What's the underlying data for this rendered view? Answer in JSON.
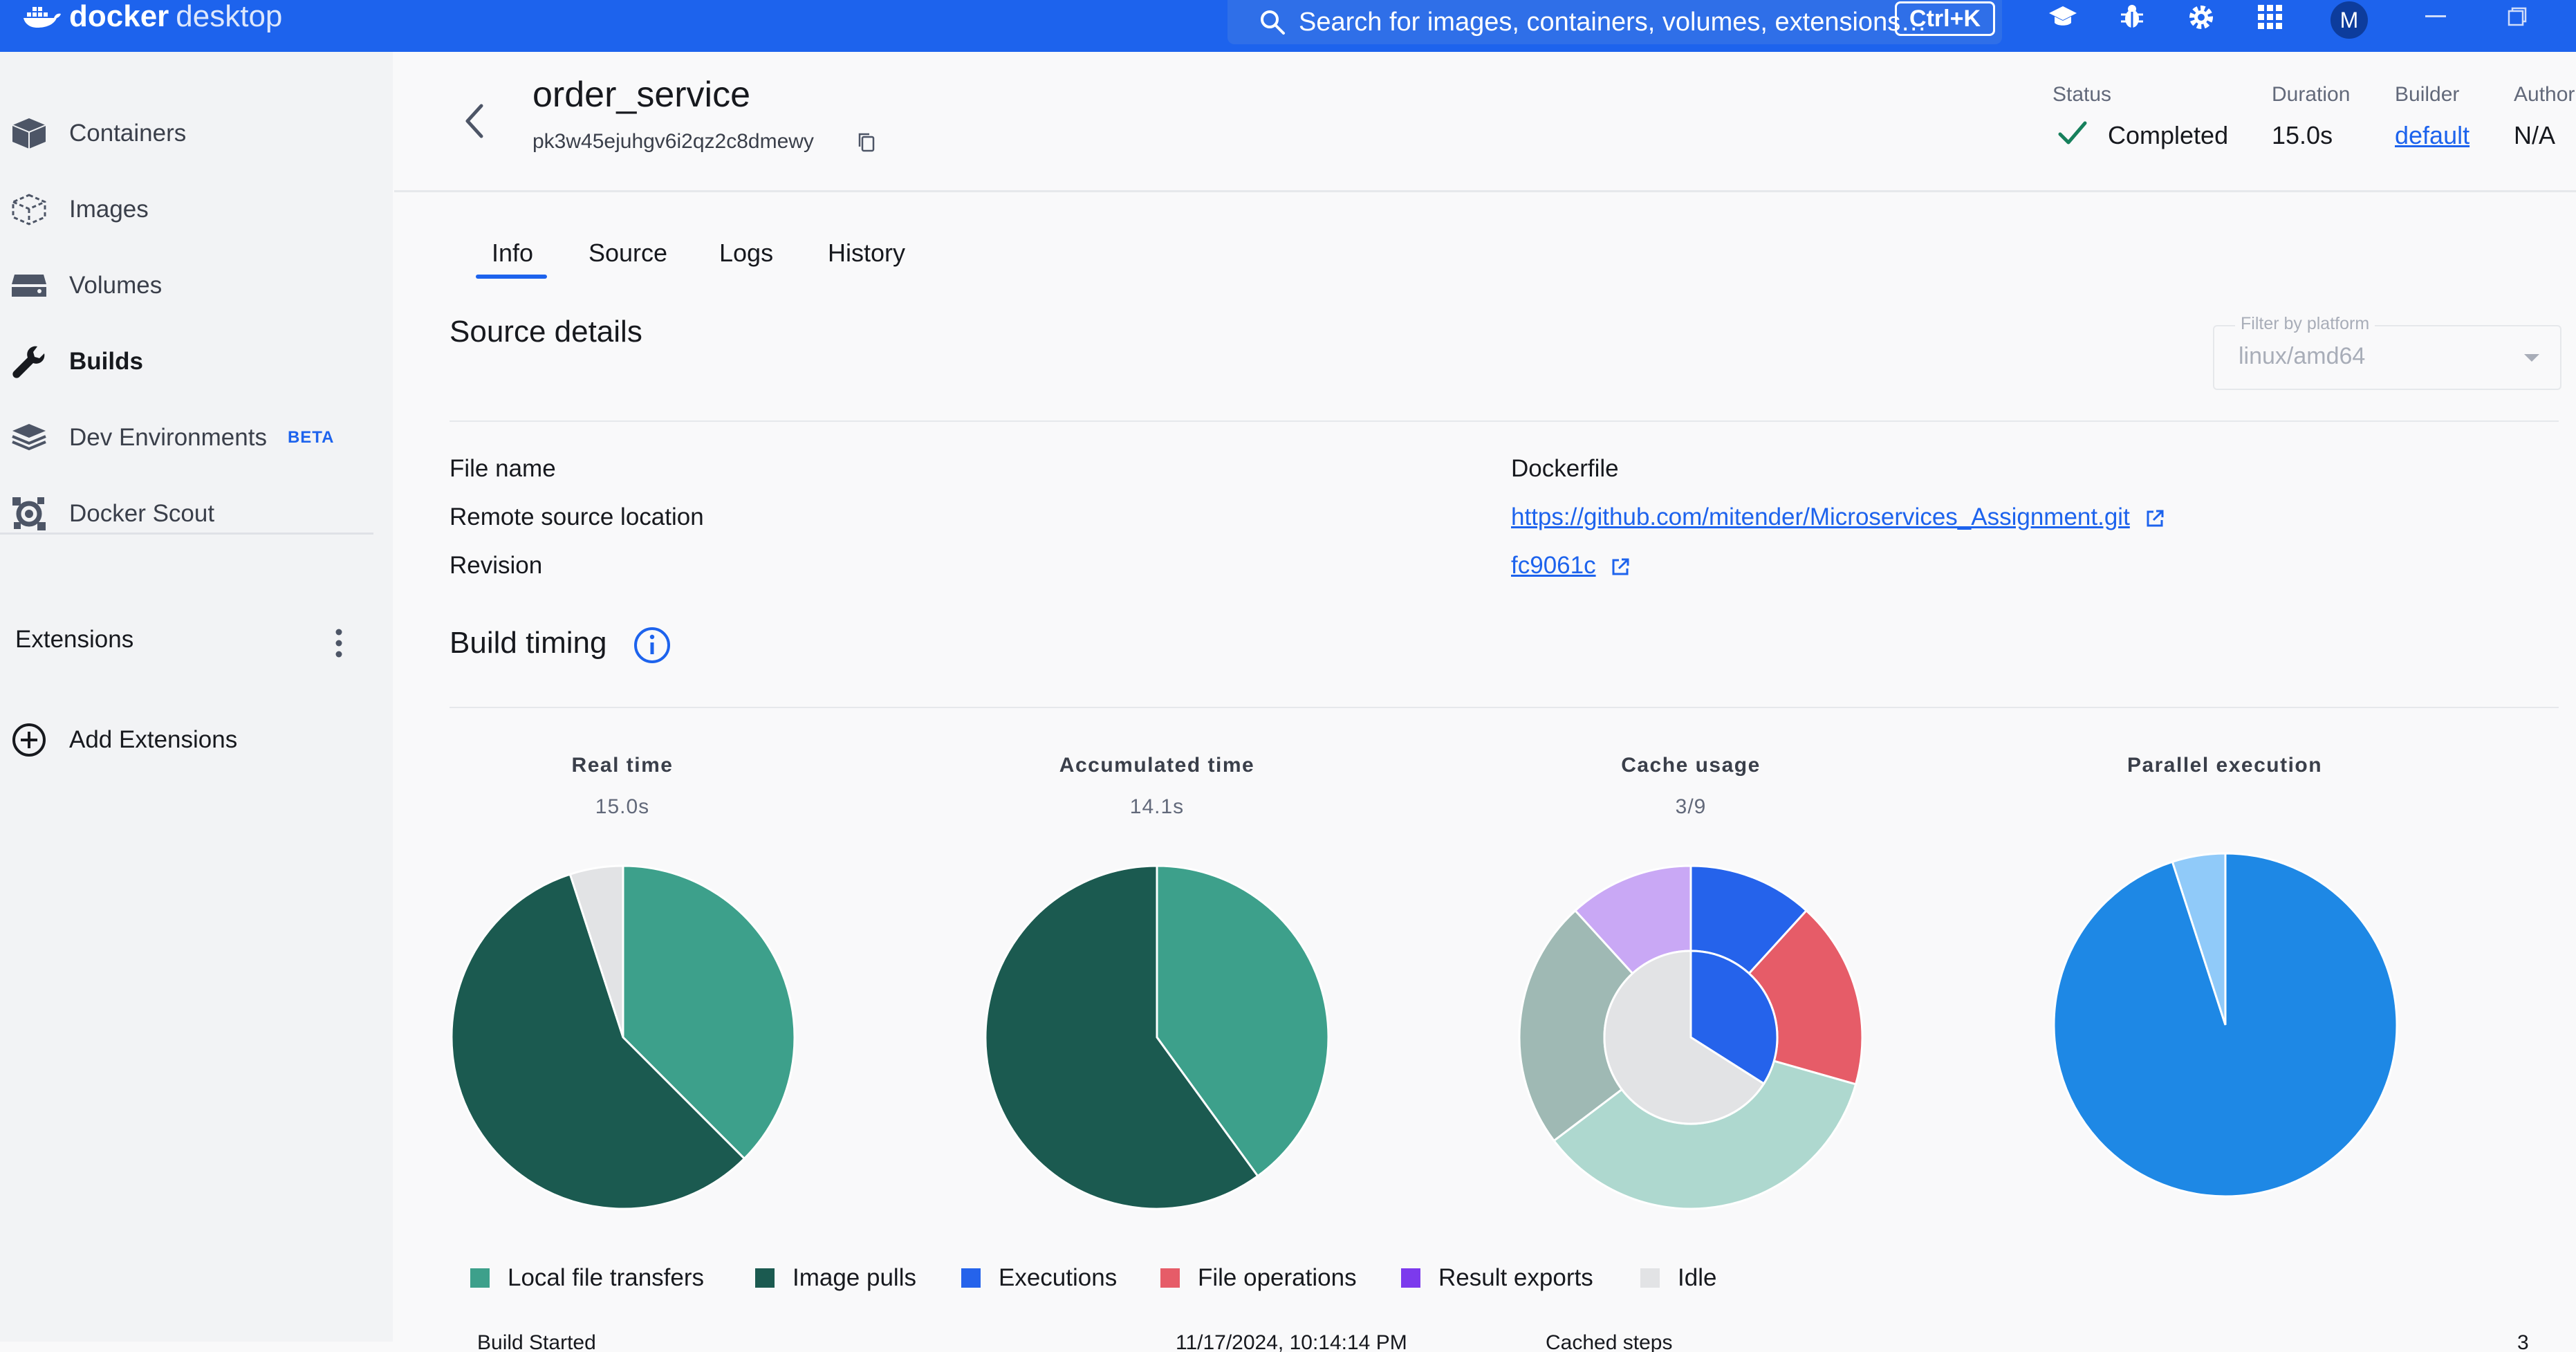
{
  "app": {
    "brand_bold": "docker",
    "brand_light": "desktop"
  },
  "topbar": {
    "search_placeholder": "Search for images, containers, volumes, extensions…",
    "search_shortcut": "Ctrl+K",
    "avatar_initial": "M",
    "brand_color": "#1d63ed"
  },
  "sidebar": {
    "items": [
      {
        "label": "Containers",
        "icon": "container-icon"
      },
      {
        "label": "Images",
        "icon": "image-icon"
      },
      {
        "label": "Volumes",
        "icon": "volume-icon"
      },
      {
        "label": "Builds",
        "icon": "wrench-icon",
        "active": true
      },
      {
        "label": "Dev Environments",
        "icon": "dev-env-icon",
        "badge": "BETA"
      },
      {
        "label": "Docker Scout",
        "icon": "scout-icon"
      }
    ],
    "extensions_label": "Extensions",
    "add_extensions_label": "Add Extensions"
  },
  "build": {
    "name": "order_service",
    "id": "pk3w45ejuhgv6i2qz2c8dmewy",
    "status_label": "Status",
    "status_value": "Completed",
    "duration_label": "Duration",
    "duration_value": "15.0s",
    "builder_label": "Builder",
    "builder_value": "default",
    "author_label": "Author",
    "author_value": "N/A"
  },
  "tabs": [
    "Info",
    "Source",
    "Logs",
    "History"
  ],
  "source_details": {
    "heading": "Source details",
    "filter_label": "Filter by platform",
    "filter_value": "linux/amd64",
    "rows": [
      {
        "key": "File name",
        "value": "Dockerfile"
      },
      {
        "key": "Remote source location",
        "value": "https://github.com/mitender/Microservices_Assignment.git"
      },
      {
        "key": "Revision",
        "value": "fc9061c"
      }
    ]
  },
  "build_timing": {
    "heading": "Build timing"
  },
  "chart_data": [
    {
      "type": "pie",
      "title": "Real time",
      "subtitle": "15.0s",
      "categories": [
        "Local file transfers",
        "Image pulls",
        "Idle"
      ],
      "values": [
        37.5,
        57.5,
        5.0
      ]
    },
    {
      "type": "pie",
      "title": "Accumulated time",
      "subtitle": "14.1s",
      "categories": [
        "Local file transfers",
        "Image pulls"
      ],
      "values": [
        40,
        60
      ]
    },
    {
      "type": "pie",
      "title": "Cache usage",
      "subtitle": "3/9",
      "outer_ring": {
        "categories": [
          "Executions",
          "File operations",
          "Local file transfers",
          "Image pulls",
          "Result exports"
        ],
        "values": [
          1,
          1.5,
          3,
          2,
          1
        ]
      },
      "inner_ring": {
        "categories": [
          "Executions",
          "Idle"
        ],
        "values": [
          1.02,
          1.98
        ]
      }
    },
    {
      "type": "pie",
      "title": "Parallel execution",
      "subtitle": "",
      "values": [
        95,
        5
      ]
    }
  ],
  "legend": [
    {
      "label": "Local file transfers",
      "color": "#3da08b"
    },
    {
      "label": "Image pulls",
      "color": "#1b5a50"
    },
    {
      "label": "Executions",
      "color": "#2563eb"
    },
    {
      "label": "File operations",
      "color": "#e65c68"
    },
    {
      "label": "Result exports",
      "color": "#7c3aed"
    },
    {
      "label": "Idle",
      "color": "#e2e3e5"
    }
  ],
  "footer_row": {
    "label": "Build Started",
    "time": "11/17/2024, 10:14:14 PM",
    "col3": "Cached steps",
    "col4": "3"
  }
}
